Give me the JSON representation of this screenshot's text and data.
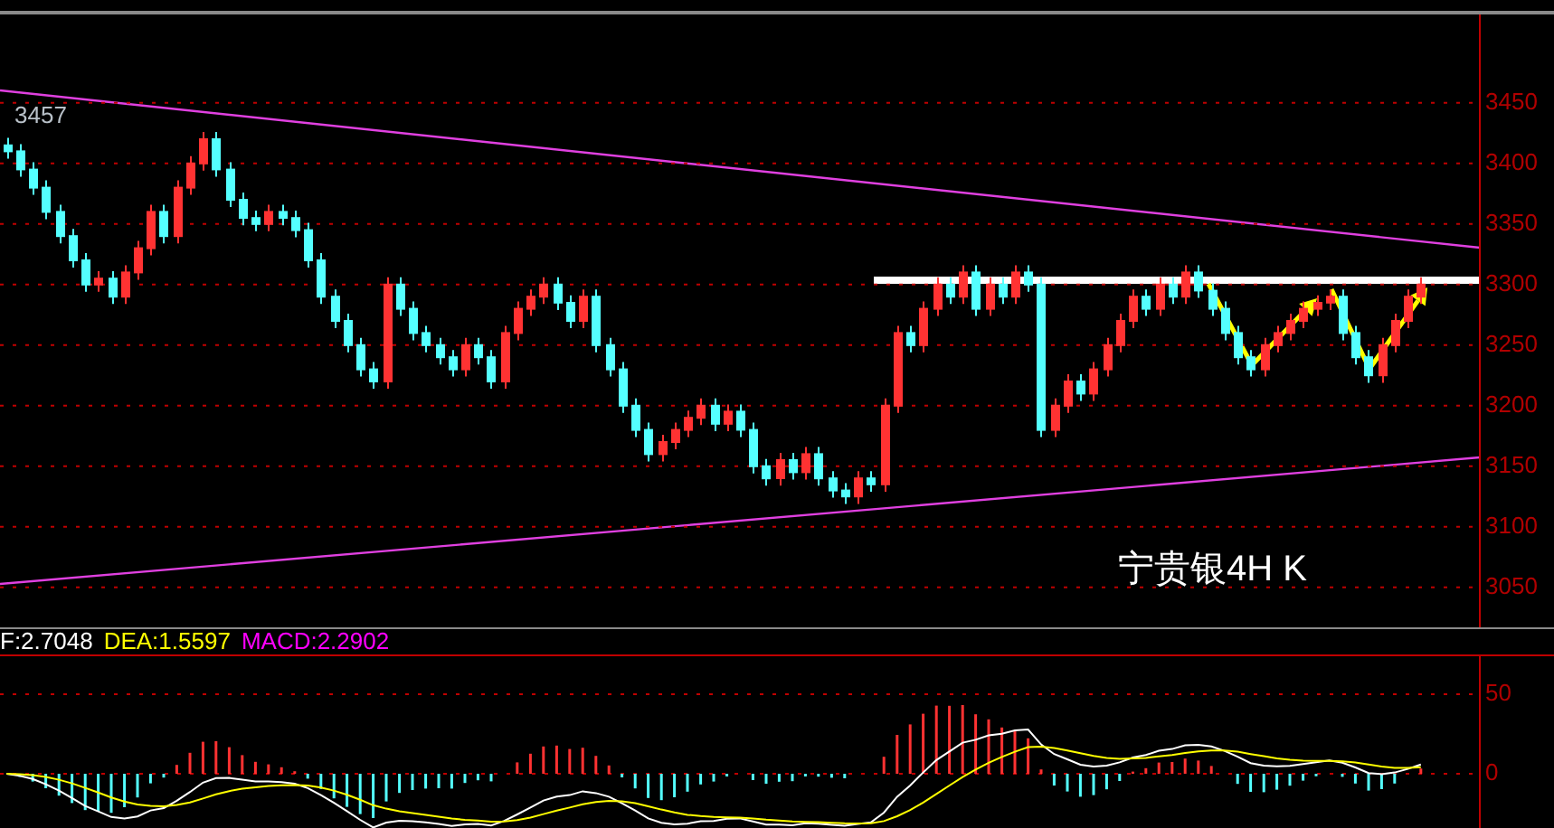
{
  "price_chart": {
    "chart_data": {
      "type": "candlestick",
      "grid": true,
      "ylim": [
        3017,
        3523
      ],
      "yticks": [
        3050,
        3100,
        3150,
        3200,
        3250,
        3300,
        3350,
        3400,
        3450
      ],
      "ohlc": [
        [
          3415,
          3421,
          3404,
          3410
        ],
        [
          3410,
          3416,
          3389,
          3395
        ],
        [
          3395,
          3401,
          3374,
          3380
        ],
        [
          3380,
          3386,
          3354,
          3360
        ],
        [
          3360,
          3366,
          3334,
          3340
        ],
        [
          3340,
          3346,
          3314,
          3320
        ],
        [
          3320,
          3326,
          3294,
          3300
        ],
        [
          3300,
          3311,
          3294,
          3305
        ],
        [
          3305,
          3311,
          3284,
          3290
        ],
        [
          3290,
          3316,
          3284,
          3310
        ],
        [
          3310,
          3336,
          3304,
          3330
        ],
        [
          3330,
          3366,
          3324,
          3360
        ],
        [
          3360,
          3366,
          3334,
          3340
        ],
        [
          3340,
          3386,
          3334,
          3380
        ],
        [
          3380,
          3406,
          3374,
          3400
        ],
        [
          3400,
          3426,
          3394,
          3420
        ],
        [
          3420,
          3426,
          3389,
          3395
        ],
        [
          3395,
          3401,
          3364,
          3370
        ],
        [
          3370,
          3376,
          3349,
          3355
        ],
        [
          3355,
          3361,
          3344,
          3350
        ],
        [
          3350,
          3366,
          3344,
          3360
        ],
        [
          3360,
          3366,
          3349,
          3355
        ],
        [
          3355,
          3361,
          3339,
          3345
        ],
        [
          3345,
          3351,
          3314,
          3320
        ],
        [
          3320,
          3326,
          3284,
          3290
        ],
        [
          3290,
          3296,
          3264,
          3270
        ],
        [
          3270,
          3276,
          3244,
          3250
        ],
        [
          3250,
          3256,
          3224,
          3230
        ],
        [
          3230,
          3236,
          3214,
          3220
        ],
        [
          3220,
          3306,
          3214,
          3300
        ],
        [
          3300,
          3306,
          3274,
          3280
        ],
        [
          3280,
          3286,
          3254,
          3260
        ],
        [
          3260,
          3266,
          3244,
          3250
        ],
        [
          3250,
          3256,
          3234,
          3240
        ],
        [
          3240,
          3246,
          3224,
          3230
        ],
        [
          3230,
          3256,
          3224,
          3250
        ],
        [
          3250,
          3256,
          3234,
          3240
        ],
        [
          3240,
          3246,
          3214,
          3220
        ],
        [
          3220,
          3266,
          3214,
          3260
        ],
        [
          3260,
          3286,
          3254,
          3280
        ],
        [
          3280,
          3296,
          3274,
          3290
        ],
        [
          3290,
          3306,
          3284,
          3300
        ],
        [
          3300,
          3306,
          3279,
          3285
        ],
        [
          3285,
          3291,
          3264,
          3270
        ],
        [
          3270,
          3296,
          3264,
          3290
        ],
        [
          3290,
          3296,
          3244,
          3250
        ],
        [
          3250,
          3256,
          3224,
          3230
        ],
        [
          3230,
          3236,
          3194,
          3200
        ],
        [
          3200,
          3206,
          3174,
          3180
        ],
        [
          3180,
          3186,
          3154,
          3160
        ],
        [
          3160,
          3176,
          3154,
          3170
        ],
        [
          3170,
          3186,
          3164,
          3180
        ],
        [
          3180,
          3196,
          3174,
          3190
        ],
        [
          3190,
          3206,
          3184,
          3200
        ],
        [
          3200,
          3206,
          3179,
          3185
        ],
        [
          3185,
          3201,
          3179,
          3195
        ],
        [
          3195,
          3201,
          3174,
          3180
        ],
        [
          3180,
          3186,
          3144,
          3150
        ],
        [
          3150,
          3156,
          3134,
          3140
        ],
        [
          3140,
          3161,
          3134,
          3155
        ],
        [
          3155,
          3161,
          3139,
          3145
        ],
        [
          3145,
          3166,
          3139,
          3160
        ],
        [
          3160,
          3166,
          3134,
          3140
        ],
        [
          3140,
          3146,
          3124,
          3130
        ],
        [
          3130,
          3136,
          3119,
          3125
        ],
        [
          3125,
          3146,
          3119,
          3140
        ],
        [
          3140,
          3146,
          3129,
          3135
        ],
        [
          3135,
          3206,
          3129,
          3200
        ],
        [
          3200,
          3266,
          3194,
          3260
        ],
        [
          3260,
          3266,
          3244,
          3250
        ],
        [
          3250,
          3286,
          3244,
          3280
        ],
        [
          3280,
          3306,
          3274,
          3300
        ],
        [
          3300,
          3306,
          3284,
          3290
        ],
        [
          3290,
          3316,
          3284,
          3310
        ],
        [
          3310,
          3316,
          3274,
          3280
        ],
        [
          3280,
          3306,
          3274,
          3300
        ],
        [
          3300,
          3306,
          3284,
          3290
        ],
        [
          3290,
          3316,
          3284,
          3310
        ],
        [
          3310,
          3316,
          3294,
          3300
        ],
        [
          3300,
          3306,
          3174,
          3180
        ],
        [
          3180,
          3206,
          3174,
          3200
        ],
        [
          3200,
          3226,
          3194,
          3220
        ],
        [
          3220,
          3226,
          3204,
          3210
        ],
        [
          3210,
          3236,
          3204,
          3230
        ],
        [
          3230,
          3256,
          3224,
          3250
        ],
        [
          3250,
          3276,
          3244,
          3270
        ],
        [
          3270,
          3296,
          3264,
          3290
        ],
        [
          3290,
          3296,
          3274,
          3280
        ],
        [
          3280,
          3306,
          3274,
          3300
        ],
        [
          3300,
          3306,
          3284,
          3290
        ],
        [
          3290,
          3316,
          3284,
          3310
        ],
        [
          3310,
          3316,
          3289,
          3295
        ],
        [
          3295,
          3301,
          3274,
          3280
        ],
        [
          3280,
          3286,
          3254,
          3260
        ],
        [
          3260,
          3266,
          3234,
          3240
        ],
        [
          3240,
          3246,
          3224,
          3230
        ],
        [
          3230,
          3256,
          3224,
          3250
        ],
        [
          3250,
          3266,
          3244,
          3260
        ],
        [
          3260,
          3276,
          3254,
          3270
        ],
        [
          3270,
          3286,
          3264,
          3280
        ],
        [
          3280,
          3291,
          3274,
          3285
        ],
        [
          3285,
          3296,
          3279,
          3290
        ],
        [
          3290,
          3296,
          3254,
          3260
        ],
        [
          3260,
          3266,
          3234,
          3240
        ],
        [
          3240,
          3246,
          3219,
          3225
        ],
        [
          3225,
          3256,
          3219,
          3250
        ],
        [
          3250,
          3276,
          3244,
          3270
        ],
        [
          3270,
          3296,
          3264,
          3290
        ],
        [
          3290,
          3306,
          3284,
          3300
        ],
        null,
        null,
        null,
        null
      ]
    },
    "annotations": [
      {
        "kind": "price-label",
        "text": "3457"
      },
      {
        "kind": "title",
        "text": "宁贵银4H K"
      }
    ]
  },
  "macd": {
    "legend": [
      {
        "text": "F:2.7048"
      },
      {
        "text": "DEA:1.5597"
      },
      {
        "text": "MACD:2.2902"
      }
    ],
    "axis_labels": [
      "50",
      "0"
    ]
  }
}
